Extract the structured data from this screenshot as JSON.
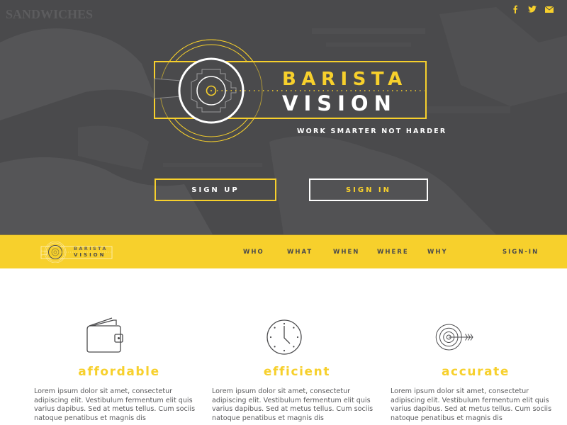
{
  "hero": {
    "brand_line1": "BARISTA",
    "brand_line2": "VISION",
    "tagline": "WORK SMARTER NOT HARDER",
    "social": [
      {
        "icon": "facebook-icon",
        "glyph": "f"
      },
      {
        "icon": "twitter-icon",
        "glyph": "bird"
      },
      {
        "icon": "email-icon",
        "glyph": "envelope"
      }
    ],
    "buttons": {
      "sign_up": "SIGN UP",
      "sign_in": "SIGN IN"
    }
  },
  "navbar": {
    "logo_line1": "BARISTA",
    "logo_line2": "VISION",
    "items": [
      "WHO",
      "WHAT",
      "WHEN",
      "WHERE",
      "WHY"
    ],
    "sign_in": "SIGN-IN"
  },
  "features": [
    {
      "icon": "wallet-icon",
      "title": "affordable",
      "text": "Lorem ipsum dolor sit amet, consectetur adipiscing elit. Vestibulum fermentum elit quis varius dapibus. Sed at metus tellus. Cum sociis natoque penatibus et magnis dis"
    },
    {
      "icon": "clock-icon",
      "title": "efficient",
      "text": "Lorem ipsum dolor sit amet, consectetur adipiscing elit. Vestibulum fermentum elit quis varius dapibus. Sed at metus tellus. Cum sociis natoque penatibus et magnis dis"
    },
    {
      "icon": "target-icon",
      "title": "accurate",
      "text": "Lorem ipsum dolor sit amet, consectetur adipiscing elit. Vestibulum fermentum elit quis varius dapibus. Sed at metus tellus. Cum sociis natoque penatibus et magnis dis"
    }
  ],
  "colors": {
    "accent": "#f7d02c",
    "dark": "#4a4a4c",
    "text": "#5a5a5c"
  }
}
